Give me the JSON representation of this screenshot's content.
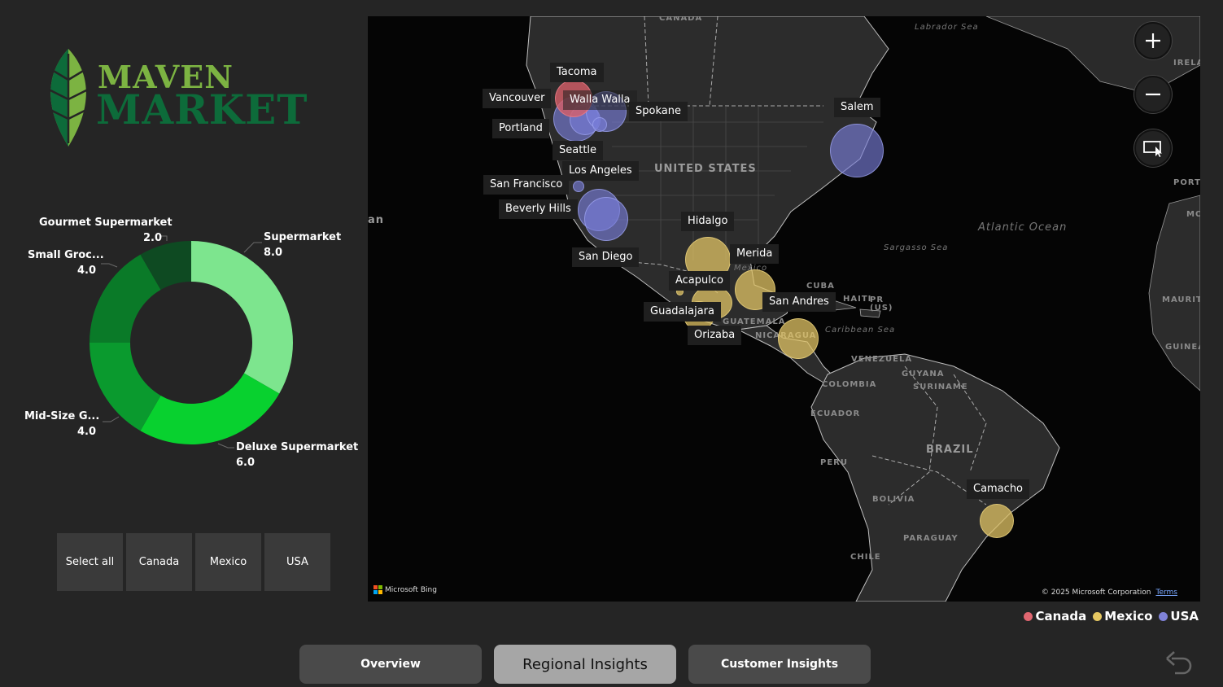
{
  "logo": {
    "word1": "MAVEN",
    "word2": "MARKET"
  },
  "donut": {
    "segments": [
      {
        "name": "Supermarket",
        "value": "8.0",
        "color": "#7de58e"
      },
      {
        "name": "Deluxe Supermarket",
        "value": "6.0",
        "color": "#08d12f"
      },
      {
        "name": "Mid-Size G...",
        "value": "4.0",
        "color": "#0a9a2e"
      },
      {
        "name": "Small Groc...",
        "value": "4.0",
        "color": "#0a7a28"
      },
      {
        "name": "Gourmet Supermarket",
        "value": "2.0",
        "color": "#0e4a22"
      }
    ]
  },
  "slicer": {
    "items": [
      "Select all",
      "Canada",
      "Mexico",
      "USA"
    ]
  },
  "map": {
    "geo": {
      "canada": "CANADA",
      "labrador": "Labrador Sea",
      "irela": "IRELA",
      "united_states": "UNITED STATES",
      "atlantic": "Atlantic Ocean",
      "sargasso": "Sargasso Sea",
      "mexico": "Mexico",
      "cuba": "CUBA",
      "haiti": "HAITI",
      "pr": "PR (US)",
      "guatemala": "GUATEMALA",
      "nicaragua": "NICARAGUA",
      "caribbean": "Caribbean Sea",
      "venezuela": "VENEZUELA",
      "guyana": "GUYANA",
      "suriname": "SURINAME",
      "colombia": "COLOMBIA",
      "ecuador": "ECUADOR",
      "peru": "PERU",
      "brazil": "BRAZIL",
      "bolivia": "BOLIVIA",
      "paragua": "PARAGUAY",
      "chile": "CHILE",
      "portu": "PORTU",
      "mo": "MO",
      "mauritan": "MAURITAN",
      "guinea": "GUINEA",
      "pacific_fragment": "an"
    },
    "cities": {
      "tacoma": "Tacoma",
      "vancouver": "Vancouver",
      "walla_walla": "Walla Walla",
      "spokane": "Spokane",
      "portland": "Portland",
      "seattle": "Seattle",
      "salem": "Salem",
      "los_angeles": "Los Angeles",
      "san_francisco": "San Francisco",
      "beverly_hills": "Beverly Hills",
      "san_diego": "San Diego",
      "hidalgo": "Hidalgo",
      "merida": "Merida",
      "acapulco": "Acapulco",
      "san_andres": "San Andres",
      "guadalajara": "Guadalajara",
      "orizaba": "Orizaba",
      "camacho": "Camacho"
    },
    "attribution": "Microsoft Bing",
    "copyright": "© 2025 Microsoft Corporation",
    "terms": "Terms"
  },
  "legend": {
    "items": [
      {
        "label": "Canada",
        "color": "#e06670"
      },
      {
        "label": "Mexico",
        "color": "#e6c862"
      },
      {
        "label": "USA",
        "color": "#7f82d8"
      }
    ]
  },
  "nav": {
    "overview": "Overview",
    "regional": "Regional Insights",
    "customer": "Customer Insights"
  },
  "icons": {
    "zoom_in": "plus-icon",
    "zoom_out": "minus-icon",
    "select": "select-area-icon",
    "back": "back-arrow-icon"
  }
}
